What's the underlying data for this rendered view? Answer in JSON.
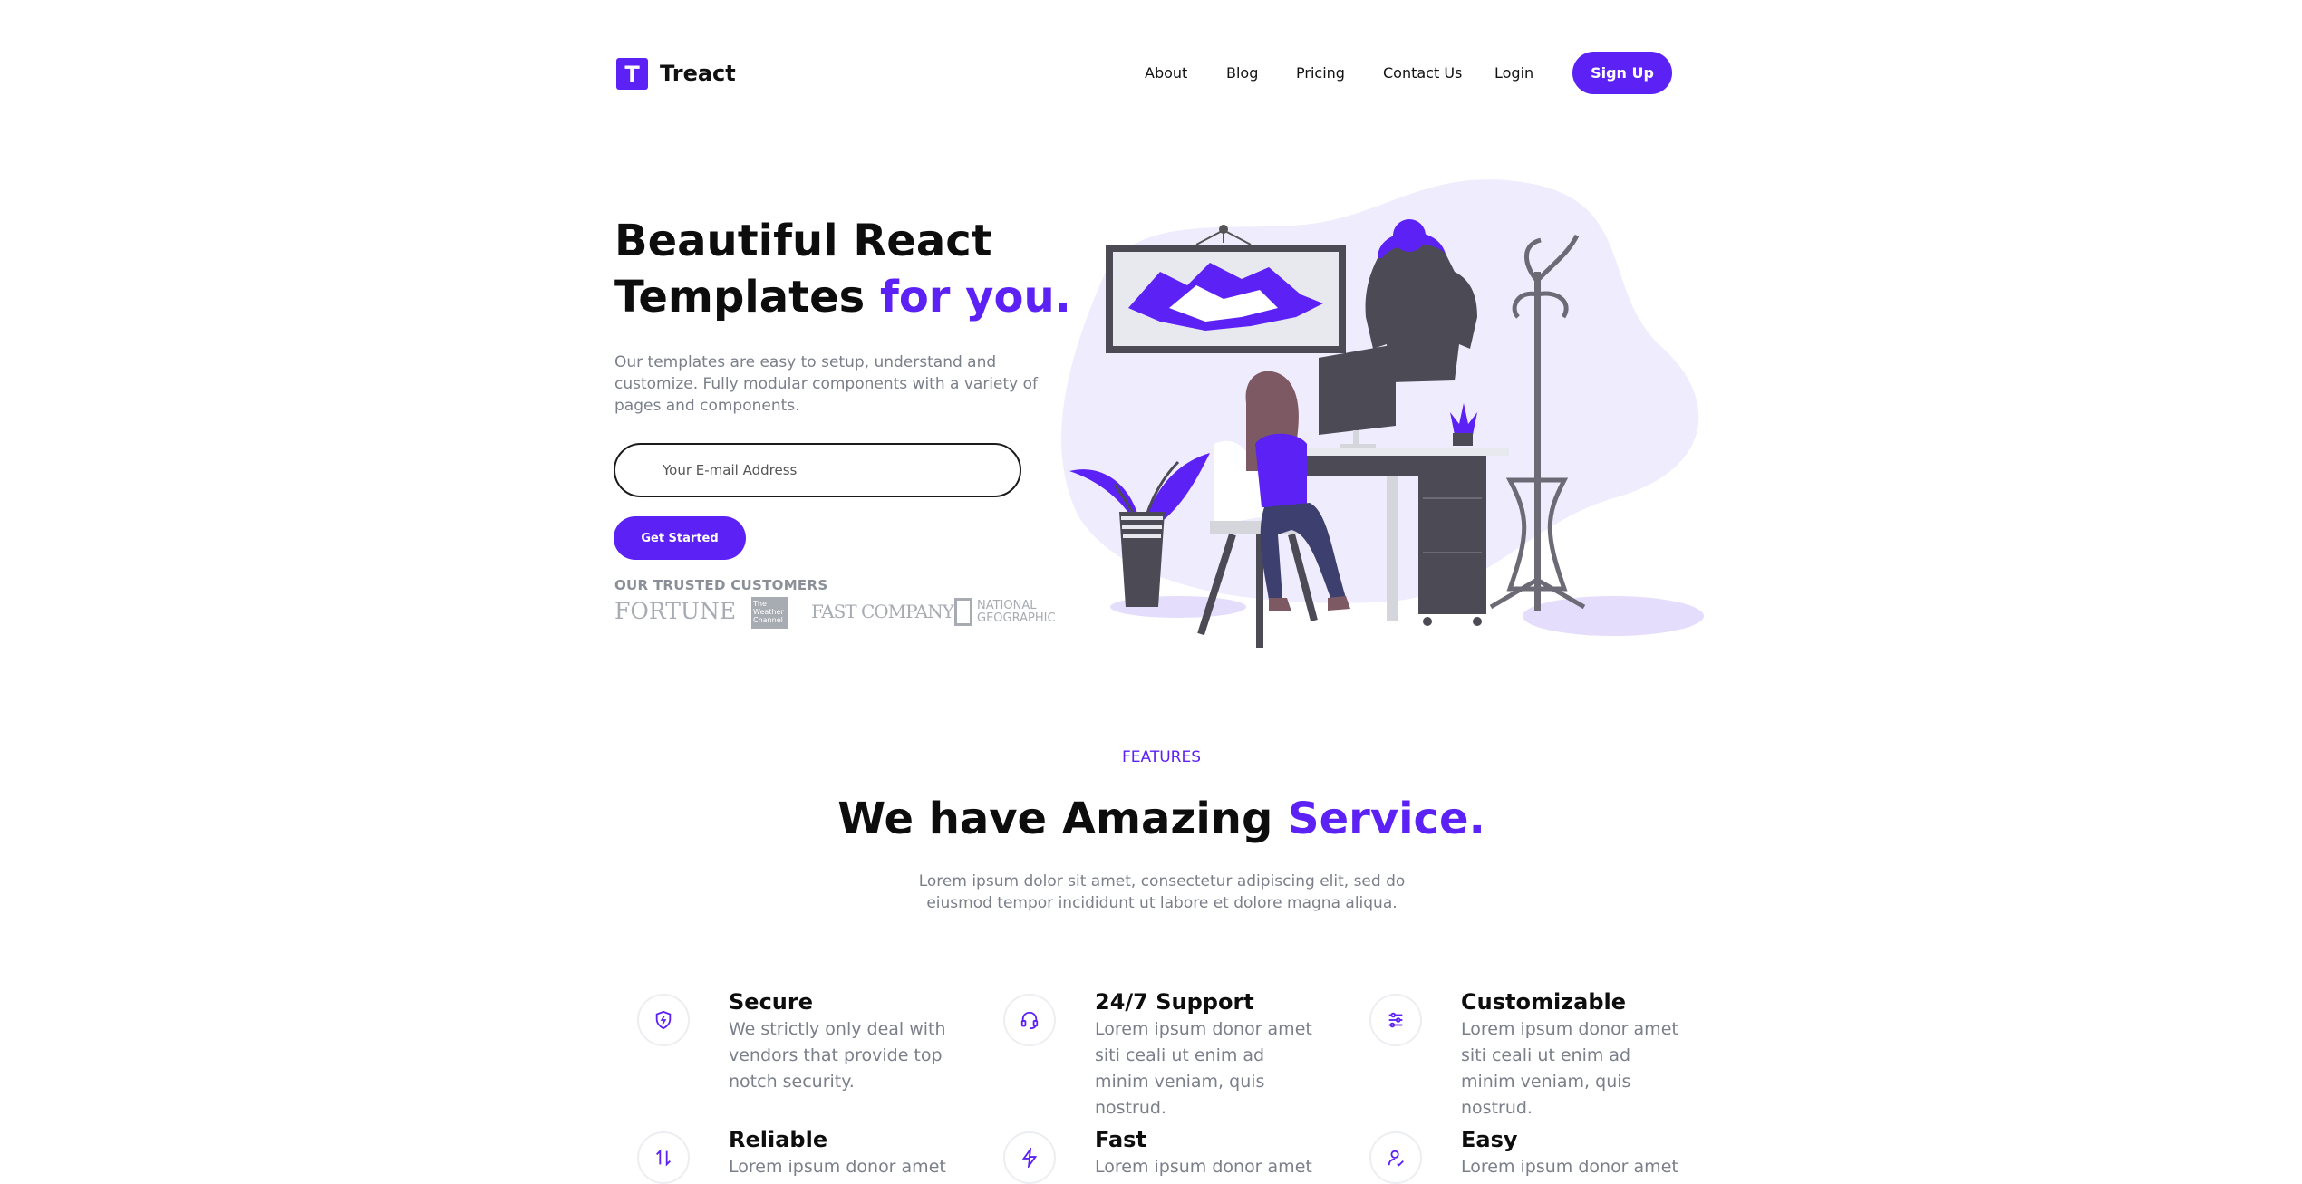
{
  "header": {
    "logo_letter": "T",
    "logo_text": "Treact",
    "nav": [
      "About",
      "Blog",
      "Pricing",
      "Contact Us",
      "Login"
    ],
    "signup_label": "Sign Up"
  },
  "hero": {
    "title_line1": "Beautiful React",
    "title_line2_plain": "Templates",
    "title_line2_accent": "for you.",
    "description": "Our templates are easy to setup, understand and customize. Fully modular components with a variety of pages and components.",
    "email_placeholder": "Your E-mail Address",
    "cta_label": "Get Started",
    "trusted_label": "OUR TRUSTED CUSTOMERS",
    "brands": {
      "fortune": "FORTUNE",
      "weather_1": "The",
      "weather_2": "Weather",
      "weather_3": "Channel",
      "fastcompany": "FAST COMPANY",
      "natgeo_1": "NATIONAL",
      "natgeo_2": "GEOGRAPHIC"
    }
  },
  "features": {
    "label": "FEATURES",
    "title_plain": "We have Amazing",
    "title_accent": "Service.",
    "description": "Lorem ipsum dolor sit amet, consectetur adipiscing elit, sed do eiusmod tempor incididunt ut labore et dolore magna aliqua.",
    "items": [
      {
        "title": "Secure",
        "desc": "We strictly only deal with vendors that provide top notch security.",
        "icon": "shield-icon"
      },
      {
        "title": "24/7 Support",
        "desc": "Lorem ipsum donor amet siti ceali ut enim ad minim veniam, quis nostrud.",
        "icon": "headset-icon"
      },
      {
        "title": "Customizable",
        "desc": "Lorem ipsum donor amet siti ceali ut enim ad minim veniam, quis nostrud.",
        "icon": "sliders-icon"
      },
      {
        "title": "Reliable",
        "desc": "Lorem ipsum donor amet",
        "icon": "arrows-updown-icon"
      },
      {
        "title": "Fast",
        "desc": "Lorem ipsum donor amet",
        "icon": "lightning-icon"
      },
      {
        "title": "Easy",
        "desc": "Lorem ipsum donor amet",
        "icon": "user-check-icon"
      }
    ]
  },
  "colors": {
    "accent": "#5b21f5",
    "muted_text": "#7a7f8a",
    "illustration_bg": "#efecfd"
  }
}
